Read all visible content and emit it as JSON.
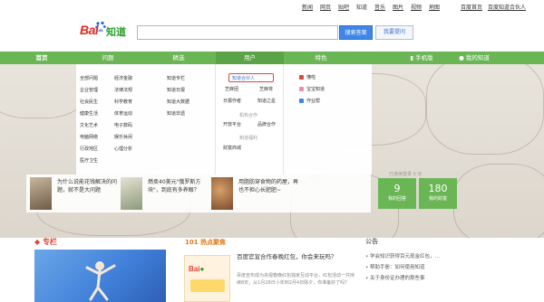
{
  "top_links": [
    "新闻",
    "网页",
    "贴吧",
    "知道",
    "音乐",
    "图片",
    "视频",
    "地图",
    "百度首页",
    "百度知道合伙人"
  ],
  "logo": {
    "bai": "Bai",
    "zhidao": "知道"
  },
  "search": {
    "placeholder": "",
    "search_label": "搜索答案",
    "ask_label": "我要提问"
  },
  "nav": {
    "home": "首页",
    "questions": "问题",
    "picks": "精选",
    "users": "用户",
    "special": "特色",
    "mobile": "手机版",
    "my": "我的知道"
  },
  "dropdown": {
    "col1": [
      "全部问题",
      "企业管理",
      "社会民生",
      "健康生活",
      "文化艺术",
      "电脑网络",
      "行政地区",
      "医疗卫生"
    ],
    "col2": [
      "经济金融",
      "法律法规",
      "科学教育",
      "体育运动",
      "电子数码",
      "娱乐休闲",
      "心理分析"
    ],
    "col3": [
      "知道专栏",
      "知道日报",
      "知道大数据",
      "知道非遗"
    ],
    "col4": [
      "知道合伙人",
      "芝麻团",
      "芝麻将",
      "日报作者",
      "知道之星",
      "机构合作",
      "开放平台",
      "品牌合作",
      "知道福利",
      "财富商城"
    ],
    "col5": [
      "懂啦",
      "宝宝知道",
      "作业帮"
    ]
  },
  "stories": [
    {
      "text": "为什么说能花钱解决的问题，就不是大问题"
    },
    {
      "text": "燃卖40美元\"俄罗斯方块\"，到底有多养眼？"
    },
    {
      "text": "用脂肪穿食物的药屋，再也不担心长肥肥~"
    }
  ],
  "user_card": {
    "tip": "已连续登录 0 天",
    "answers_num": "9",
    "answers_label": "我的回答",
    "wealth_num": "180",
    "wealth_label": "我的财富"
  },
  "hot": {
    "title": "热点聚焦",
    "badge": "101",
    "headline": "百度官宣合作春晚红包，你会来玩吗？",
    "desc": "百度宣布成为央视春晚红包独家互动平台，红包活动一共持续8天，从1月28日小年到2月4日除夕，你准备好了吗？"
  },
  "notice": {
    "title": "公告",
    "items": [
      "• 学会知识获得百元现金红包，…",
      "• 帮助手册：如何使用知道",
      "• 关于身份证办理的那些事"
    ]
  },
  "colors": {
    "green": "#6ab654",
    "blue": "#3f86e8",
    "red": "#e2453a"
  }
}
